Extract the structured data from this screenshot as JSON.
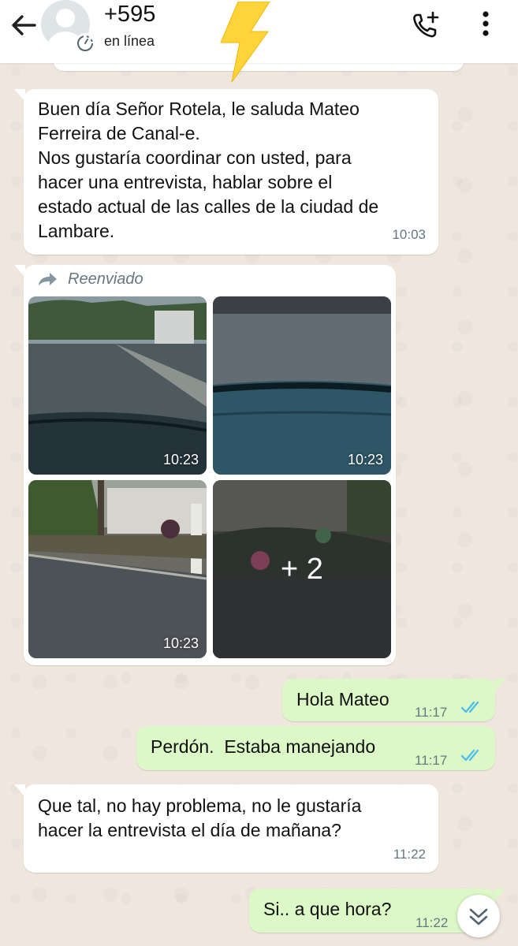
{
  "header": {
    "contact_name": "+595",
    "status": "en línea"
  },
  "messages": [
    {
      "direction": "in",
      "text": "Buen día Señor Rotela, le saluda Mateo\nFerreira de Canal-e.\nNos gustaría coordinar con usted, para\nhacer una entrevista, hablar sobre el\nestado actual de las calles de la ciudad de\nLambare.",
      "time": "10:03"
    },
    {
      "direction": "in",
      "forwarded_label": "Reenviado",
      "photos": [
        {
          "time": "10:23"
        },
        {
          "time": "10:23"
        },
        {
          "time": "10:23"
        },
        {
          "more": "+ 2"
        }
      ]
    },
    {
      "direction": "out",
      "text": "Hola Mateo",
      "time": "11:17",
      "status": "read"
    },
    {
      "direction": "out",
      "text": "Perdón.  Estaba manejando",
      "time": "11:17",
      "status": "read"
    },
    {
      "direction": "in",
      "text": "Que tal, no hay problema, no le gustaría\nhacer la entrevista el día de mañana?",
      "time": "11:22"
    },
    {
      "direction": "out",
      "text": "Si.. a que hora?",
      "time": "11:22"
    }
  ],
  "icons": {
    "back": "arrow-left-icon",
    "timer": "disappearing-timer-icon",
    "call": "add-call-icon",
    "menu": "more-vert-icon",
    "emoji": "high-voltage-emoji",
    "forwarded": "forwarded-icon",
    "read_ticks": "double-check-icon",
    "scroll_down": "chevron-double-down-icon"
  },
  "colors": {
    "chat_background": "#efe7de",
    "incoming_bubble": "#ffffff",
    "outgoing_bubble": "#dcf8c6",
    "read_ticks": "#53bdeb",
    "time_text": "#667781"
  }
}
